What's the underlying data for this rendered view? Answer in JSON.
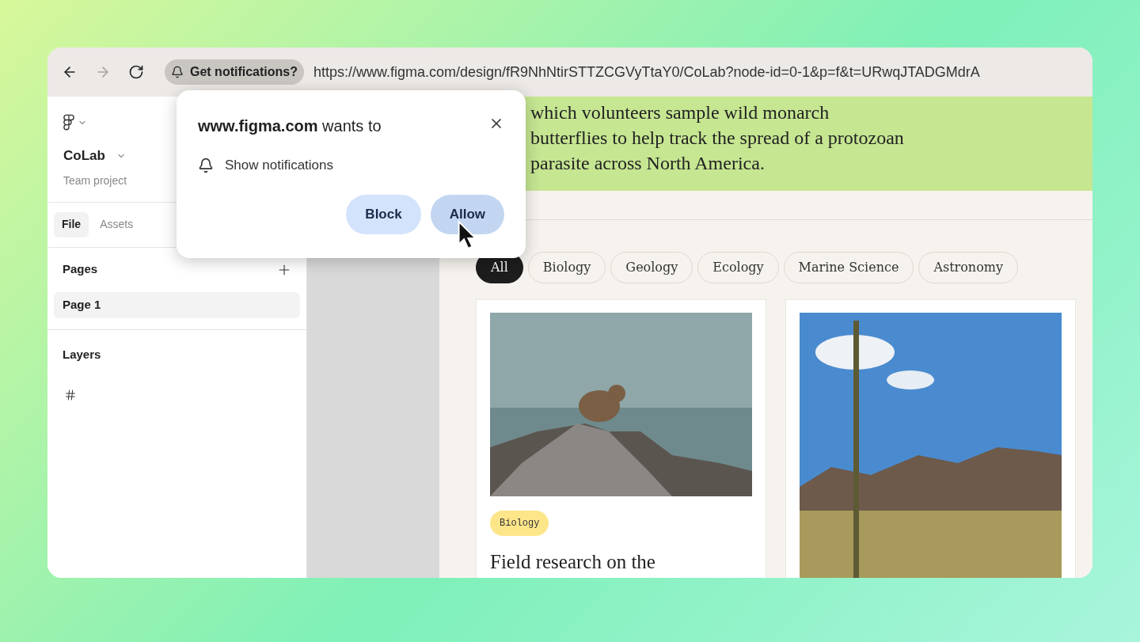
{
  "browser": {
    "nav_buttons": [
      {
        "kind": "back",
        "disabled": false
      },
      {
        "kind": "forward",
        "disabled": true
      },
      {
        "kind": "reload",
        "disabled": false
      }
    ],
    "notification_chip": "Get notifications?",
    "url": "https://www.figma.com/design/fR9NhNtirSTTZCGVyTtaY0/CoLab?node-id=0-1&p=f&t=URwqJTADGMdrA"
  },
  "sidebar": {
    "project": "CoLab",
    "team": "Team project",
    "tabs": [
      {
        "label": "File",
        "selected": true
      },
      {
        "label": "Assets",
        "selected": false
      }
    ],
    "pages_title": "Pages",
    "pages": [
      {
        "label": "Page 1",
        "selected": true
      }
    ],
    "layers_title": "Layers"
  },
  "content": {
    "banner_lines": [
      "which volunteers sample wild monarch",
      "butterflies to help track the spread of a protozoan",
      "parasite across North America."
    ],
    "filters": [
      {
        "label": "All",
        "selected": true
      },
      {
        "label": "Biology",
        "selected": false
      },
      {
        "label": "Geology",
        "selected": false
      },
      {
        "label": "Ecology",
        "selected": false
      },
      {
        "label": "Marine Science",
        "selected": false
      },
      {
        "label": "Astronomy",
        "selected": false
      }
    ],
    "cards": [
      {
        "kind": "animal",
        "tag": "Biology",
        "color": "#fde68a",
        "title": "Field research on the"
      },
      {
        "kind": "landscape"
      }
    ]
  },
  "permission_popup": {
    "site": "www.figma.com",
    "request": "wants to",
    "permission": "Show notifications",
    "buttons": [
      {
        "label": "Block",
        "hovered": false
      },
      {
        "label": "Allow",
        "hovered": true
      }
    ]
  }
}
